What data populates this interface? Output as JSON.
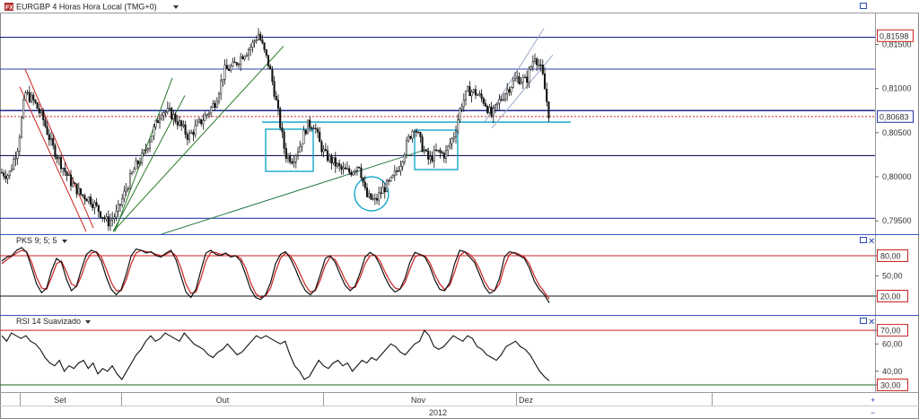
{
  "header": {
    "symbol_title": "EURGBP 4 Horas Hora Local (TMG+0)",
    "icon": "fx-logo-icon"
  },
  "price_panel": {
    "tick_labels": [
      "0,81500",
      "0,81000",
      "0,80500",
      "0,80000",
      "0,79500"
    ],
    "current_price": "0,80683",
    "high_marker": "0,81598",
    "colors": {
      "price_box": "#2233aa",
      "high_box": "#cc2222",
      "hline": "#2222aa",
      "support": "#00a0c8"
    }
  },
  "stoch_panel": {
    "title": "PKS 9; 5; 5",
    "tick_labels": [
      "80,00",
      "50,00",
      "20,00"
    ]
  },
  "rsi_panel": {
    "title": "RSI 14 Suavizado",
    "tick_labels": [
      "70,00",
      "60,00",
      "40,00",
      "30,00"
    ]
  },
  "time_axis": {
    "months": [
      "Set",
      "Out",
      "Nov",
      "Dez"
    ],
    "year": "2012"
  },
  "chart_data": [
    {
      "type": "candlestick",
      "title": "EURGBP 4 Horas Hora Local (TMG+0)",
      "ylim": [
        0.7935,
        0.8185
      ],
      "y_ticks": [
        0.815,
        0.81,
        0.805,
        0.8,
        0.795
      ],
      "x_labels": [
        "Set",
        "Out",
        "Nov",
        "Dez"
      ],
      "close_path": [
        [
          0,
          0.8005
        ],
        [
          10,
          0.8002
        ],
        [
          20,
          0.8035
        ],
        [
          28,
          0.8095
        ],
        [
          38,
          0.8085
        ],
        [
          48,
          0.8065
        ],
        [
          58,
          0.8035
        ],
        [
          68,
          0.8015
        ],
        [
          78,
          0.7995
        ],
        [
          90,
          0.798
        ],
        [
          100,
          0.7975
        ],
        [
          110,
          0.7962
        ],
        [
          120,
          0.7948
        ],
        [
          130,
          0.7958
        ],
        [
          140,
          0.7985
        ],
        [
          150,
          0.801
        ],
        [
          160,
          0.8025
        ],
        [
          170,
          0.805
        ],
        [
          180,
          0.8075
        ],
        [
          190,
          0.8072
        ],
        [
          200,
          0.806
        ],
        [
          210,
          0.8045
        ],
        [
          220,
          0.8058
        ],
        [
          230,
          0.807
        ],
        [
          240,
          0.8085
        ],
        [
          250,
          0.812
        ],
        [
          260,
          0.8125
        ],
        [
          270,
          0.8138
        ],
        [
          280,
          0.8148
        ],
        [
          288,
          0.8162
        ],
        [
          295,
          0.814
        ],
        [
          300,
          0.8125
        ],
        [
          306,
          0.8095
        ],
        [
          312,
          0.806
        ],
        [
          318,
          0.8025
        ],
        [
          326,
          0.802
        ],
        [
          334,
          0.8035
        ],
        [
          342,
          0.8058
        ],
        [
          350,
          0.806
        ],
        [
          356,
          0.8038
        ],
        [
          362,
          0.8025
        ],
        [
          370,
          0.8018
        ],
        [
          380,
          0.8008
        ],
        [
          390,
          0.8005
        ],
        [
          400,
          0.8015
        ],
        [
          408,
          0.7978
        ],
        [
          418,
          0.7972
        ],
        [
          426,
          0.7985
        ],
        [
          436,
          0.7995
        ],
        [
          446,
          0.8015
        ],
        [
          456,
          0.8045
        ],
        [
          462,
          0.8058
        ],
        [
          470,
          0.8035
        ],
        [
          478,
          0.8018
        ],
        [
          486,
          0.8028
        ],
        [
          496,
          0.8025
        ],
        [
          506,
          0.8048
        ],
        [
          514,
          0.8082
        ],
        [
          522,
          0.8098
        ],
        [
          530,
          0.8095
        ],
        [
          540,
          0.8085
        ],
        [
          548,
          0.8068
        ],
        [
          556,
          0.8085
        ],
        [
          566,
          0.81
        ],
        [
          576,
          0.8112
        ],
        [
          586,
          0.8108
        ],
        [
          596,
          0.8138
        ],
        [
          604,
          0.8118
        ],
        [
          612,
          0.8068
        ]
      ],
      "horizontal_lines": [
        0.8158,
        0.8122,
        0.8075,
        0.8024,
        0.7953
      ],
      "support_line": 0.8062,
      "current_price": 0.80683,
      "high": 0.81598
    },
    {
      "type": "line",
      "title": "PKS 9; 5; 5",
      "ylim": [
        0,
        100
      ],
      "y_ticks": [
        80,
        50,
        20
      ],
      "levels": [
        80,
        20
      ],
      "series": [
        {
          "values": [
            72,
            78,
            80,
            88,
            92,
            85,
            62,
            38,
            25,
            32,
            58,
            76,
            70,
            45,
            28,
            35,
            60,
            82,
            88,
            85,
            72,
            48,
            30,
            22,
            30,
            52,
            80,
            90,
            88,
            84,
            86,
            80,
            78,
            84,
            88,
            74,
            50,
            26,
            18,
            30,
            58,
            84,
            88,
            82,
            80,
            84,
            78,
            80,
            72,
            52,
            30,
            18,
            15,
            22,
            40,
            68,
            82,
            86,
            76,
            60,
            42,
            28,
            22,
            30,
            52,
            76,
            80,
            70,
            52,
            36,
            28,
            35,
            55,
            78,
            85,
            80,
            66,
            48,
            34,
            26,
            30,
            46,
            70,
            85,
            82,
            78,
            64,
            44,
            30,
            28,
            40,
            68,
            88,
            86,
            78,
            70,
            52,
            34,
            24,
            28,
            46,
            78,
            86,
            84,
            80,
            76,
            62,
            42,
            30,
            22,
            10
          ]
        },
        {
          "values": [
            68,
            74,
            79,
            84,
            88,
            86,
            70,
            48,
            32,
            30,
            48,
            68,
            72,
            56,
            38,
            34,
            50,
            72,
            84,
            86,
            78,
            60,
            40,
            28,
            28,
            44,
            68,
            84,
            88,
            86,
            85,
            82,
            80,
            82,
            86,
            80,
            62,
            38,
            24,
            26,
            46,
            72,
            85,
            85,
            82,
            83,
            80,
            80,
            76,
            62,
            40,
            24,
            18,
            20,
            32,
            56,
            76,
            84,
            80,
            68,
            52,
            36,
            26,
            28,
            44,
            66,
            78,
            74,
            60,
            44,
            32,
            33,
            48,
            68,
            80,
            81,
            72,
            56,
            42,
            32,
            30,
            40,
            60,
            78,
            82,
            80,
            70,
            52,
            38,
            30,
            36,
            56,
            80,
            86,
            82,
            74,
            60,
            42,
            30,
            28,
            38,
            64,
            82,
            85,
            82,
            78,
            68,
            50,
            36,
            26,
            16
          ]
        }
      ]
    },
    {
      "type": "line",
      "title": "RSI 14 Suavizado",
      "ylim": [
        28,
        76
      ],
      "y_ticks": [
        70,
        60,
        40,
        30
      ],
      "levels": [
        70,
        30
      ],
      "series": [
        {
          "values": [
            66,
            62,
            68,
            66,
            64,
            66,
            62,
            60,
            56,
            50,
            46,
            44,
            48,
            40,
            44,
            42,
            46,
            48,
            42,
            46,
            38,
            42,
            40,
            44,
            38,
            34,
            40,
            46,
            52,
            56,
            62,
            66,
            62,
            64,
            68,
            66,
            64,
            62,
            68,
            64,
            60,
            58,
            56,
            52,
            50,
            54,
            56,
            60,
            56,
            52,
            54,
            58,
            62,
            66,
            64,
            66,
            64,
            62,
            60,
            62,
            52,
            44,
            40,
            34,
            36,
            42,
            48,
            44,
            42,
            46,
            48,
            44,
            46,
            40,
            44,
            48,
            46,
            50,
            48,
            52,
            56,
            60,
            58,
            54,
            52,
            56,
            60,
            62,
            70,
            66,
            58,
            56,
            58,
            62,
            66,
            64,
            62,
            66,
            64,
            58,
            56,
            52,
            50,
            48,
            52,
            58,
            60,
            62,
            58,
            56,
            52,
            46,
            40,
            36,
            33
          ]
        }
      ]
    }
  ]
}
